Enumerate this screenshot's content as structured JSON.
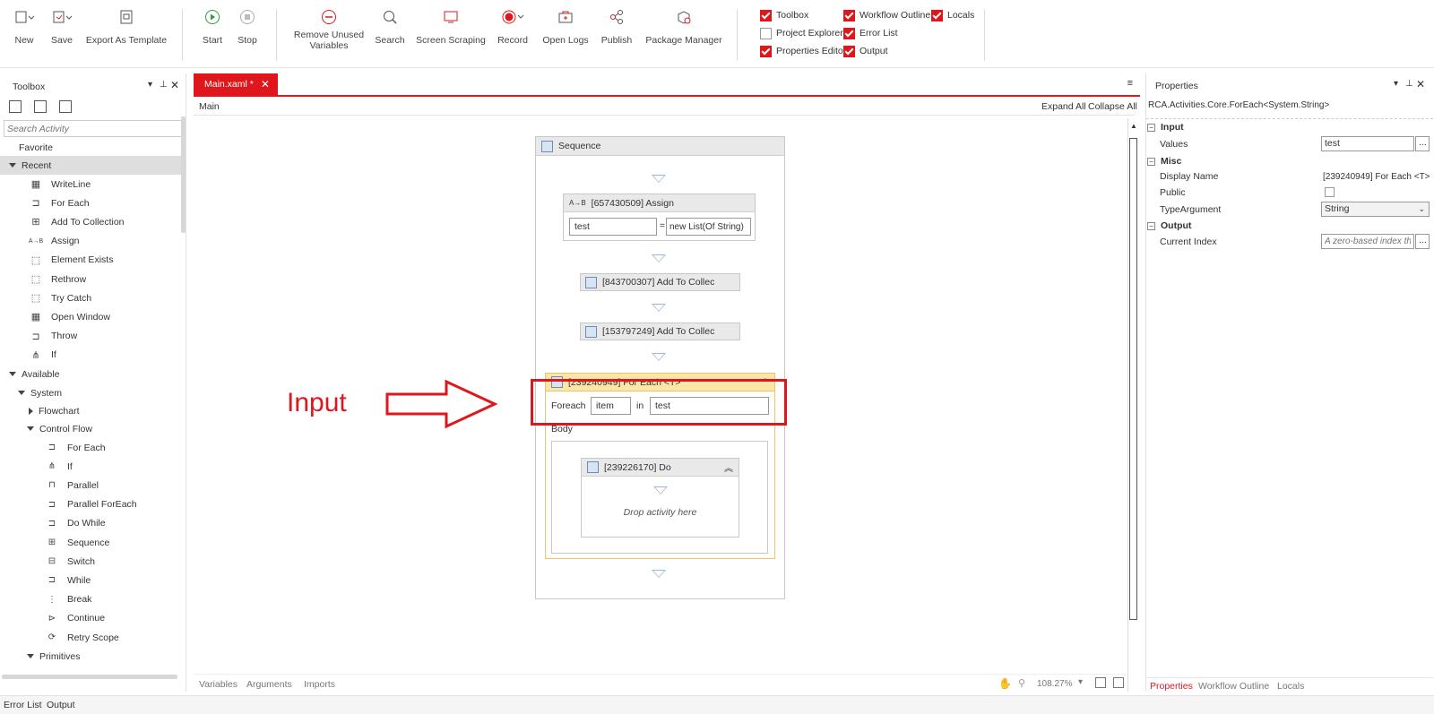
{
  "toolbar": {
    "new": "New",
    "save": "Save",
    "export_template": "Export As Template",
    "start": "Start",
    "stop": "Stop",
    "remove_unused_1": "Remove Unused",
    "remove_unused_2": "Variables",
    "search": "Search",
    "screen_scraping": "Screen Scraping",
    "record": "Record",
    "open_logs": "Open Logs",
    "publish": "Publish",
    "package_manager": "Package Manager"
  },
  "panels_toggle": {
    "toolbox": {
      "label": "Toolbox",
      "checked": true
    },
    "workflow_outline": {
      "label": "Workflow Outline",
      "checked": true
    },
    "locals": {
      "label": "Locals",
      "checked": true
    },
    "project_explorer": {
      "label": "Project Explorer",
      "checked": false
    },
    "error_list": {
      "label": "Error List",
      "checked": true
    },
    "properties_editor": {
      "label": "Properties Editor",
      "checked": true
    },
    "output": {
      "label": "Output",
      "checked": true
    }
  },
  "toolbox": {
    "title": "Toolbox",
    "search_placeholder": "Search Activity",
    "favorite": "Favorite",
    "recent": "Recent",
    "recent_items": [
      "WriteLine",
      "For Each",
      "Add To Collection",
      "Assign",
      "Element Exists",
      "Rethrow",
      "Try Catch",
      "Open Window",
      "Throw",
      "If"
    ],
    "available": "Available",
    "system": "System",
    "flowchart": "Flowchart",
    "control_flow": "Control Flow",
    "control_flow_items": [
      "For Each",
      "If",
      "Parallel",
      "Parallel ForEach",
      "Do While",
      "Sequence",
      "Switch",
      "While",
      "Break",
      "Continue",
      "Retry Scope"
    ],
    "primitives": "Primitives"
  },
  "editor": {
    "tab": "Main.xaml *",
    "breadcrumb": "Main",
    "expand_all": "Expand All",
    "collapse_all": "Collapse All",
    "sequence": "Sequence",
    "assign_title": "[657430509] Assign",
    "assign_to": "test",
    "assign_value": "new List(Of String)",
    "add1": "[843700307] Add To Collec",
    "add2": "[153797249] Add To Collec",
    "foreach_title": "[239240949] For Each <T>",
    "foreach_label": "Foreach",
    "foreach_item": "item",
    "foreach_in": "in",
    "foreach_values": "test",
    "body": "Body",
    "do_title": "[239226170] Do",
    "drop_hint": "Drop activity here",
    "annotation": "Input",
    "annotation_color": "#e0161d",
    "bottom_tabs": [
      "Variables",
      "Arguments",
      "Imports"
    ],
    "zoom": "108.27%"
  },
  "properties": {
    "title": "Properties",
    "type": "RCA.Activities.Core.ForEach<System.String>",
    "sec_input": "Input",
    "values_label": "Values",
    "values_value": "test",
    "sec_misc": "Misc",
    "display_name_label": "Display Name",
    "display_name_value": "[239240949] For Each <T>",
    "public_label": "Public",
    "type_arg_label": "TypeArgument",
    "type_arg_value": "String",
    "sec_output": "Output",
    "current_index_label": "Current Index",
    "current_index_placeholder": "A zero-based index th",
    "bottom_tabs": [
      "Properties",
      "Workflow Outline",
      "Locals"
    ]
  },
  "statusbar": [
    "Error List",
    "Output"
  ],
  "accent": "#e0161d"
}
